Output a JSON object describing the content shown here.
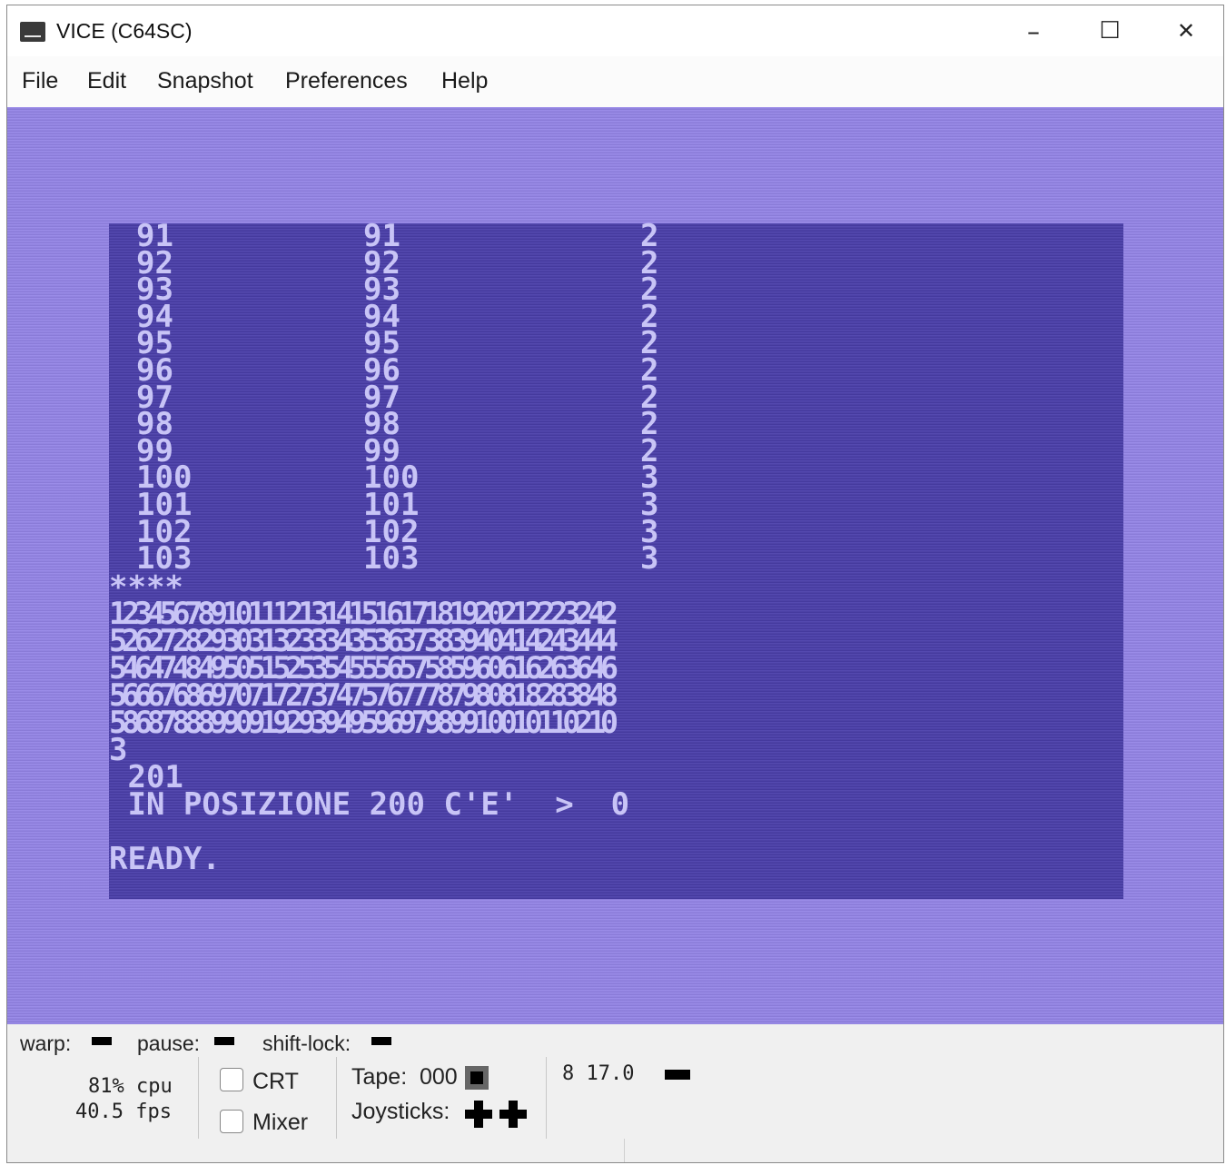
{
  "window": {
    "title": "VICE (C64SC)",
    "controls": {
      "minimize": "–",
      "maximize": "☐",
      "close": "✕"
    }
  },
  "menubar": {
    "items": [
      "File",
      "Edit",
      "Snapshot",
      "Preferences",
      "Help"
    ]
  },
  "c64_screen": {
    "border_color": "#9383e6",
    "background_color": "#4b3fab",
    "text_color": "#c8c4f6",
    "table_rows": [
      {
        "a": "91",
        "b": "91",
        "c": "2"
      },
      {
        "a": "92",
        "b": "92",
        "c": "2"
      },
      {
        "a": "93",
        "b": "93",
        "c": "2"
      },
      {
        "a": "94",
        "b": "94",
        "c": "2"
      },
      {
        "a": "95",
        "b": "95",
        "c": "2"
      },
      {
        "a": "96",
        "b": "96",
        "c": "2"
      },
      {
        "a": "97",
        "b": "97",
        "c": "2"
      },
      {
        "a": "98",
        "b": "98",
        "c": "2"
      },
      {
        "a": "99",
        "b": "99",
        "c": "2"
      },
      {
        "a": "100",
        "b": "100",
        "c": "3"
      },
      {
        "a": "101",
        "b": "101",
        "c": "3"
      },
      {
        "a": "102",
        "b": "102",
        "c": "3"
      },
      {
        "a": "103",
        "b": "103",
        "c": "3"
      }
    ],
    "lines": [
      "****",
      "1234567891011121314151617181920212223242",
      "5262728293031323334353637383940414243444",
      "5464748495051525354555657585960616263646",
      "5666768697071727374757677787980818283848",
      "5868788899091929394959697989910010110210",
      "3",
      " 201",
      " IN POSIZIONE 200 C'E'  >  0",
      "",
      "READY."
    ]
  },
  "statusbar": {
    "warp_label": "warp:",
    "pause_label": "pause:",
    "shift_lock_label": "shift-lock:",
    "cpu": "81% cpu",
    "fps": "40.5 fps",
    "crt_label": "CRT",
    "mixer_label": "Mixer",
    "tape_label": "Tape:",
    "tape_counter": "000",
    "joysticks_label": "Joysticks:",
    "drive_info": "8 17.0"
  }
}
